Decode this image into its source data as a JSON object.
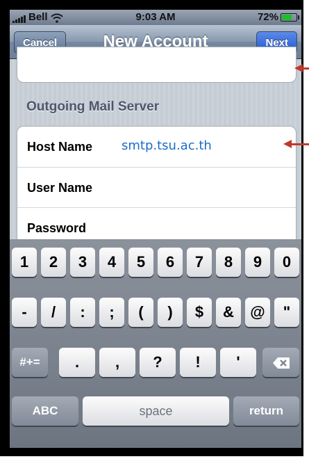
{
  "status_bar": {
    "carrier": "Bell",
    "time": "9:03 AM",
    "battery": "72%",
    "battery_level": 0.72
  },
  "nav": {
    "title": "New Account",
    "cancel_label": "Cancel",
    "next_label": "Next"
  },
  "section": {
    "header": "Outgoing Mail Server",
    "rows": [
      {
        "label": "Host Name",
        "value": "smtp.tsu.ac.th"
      },
      {
        "label": "User Name",
        "value": ""
      },
      {
        "label": "Password",
        "value": ""
      }
    ]
  },
  "keyboard": {
    "row1": [
      "1",
      "2",
      "3",
      "4",
      "5",
      "6",
      "7",
      "8",
      "9",
      "0"
    ],
    "row2": [
      "-",
      "/",
      ":",
      ";",
      "(",
      ")",
      "$",
      "&",
      "@",
      "\""
    ],
    "row3": [
      ".",
      ",",
      "?",
      "!",
      "'"
    ],
    "symbols_key": "#+=",
    "backspace_icon": "backspace-icon",
    "abc_key": "ABC",
    "space_key": "space",
    "return_key": "return"
  },
  "colors": {
    "nav_next": "#2356d1",
    "field_value": "#1a6cc9",
    "callout": "#c0392b"
  },
  "icons": [
    "wifi-icon",
    "battery-icon",
    "signal-icon",
    "backspace-icon",
    "callout-arrow"
  ]
}
